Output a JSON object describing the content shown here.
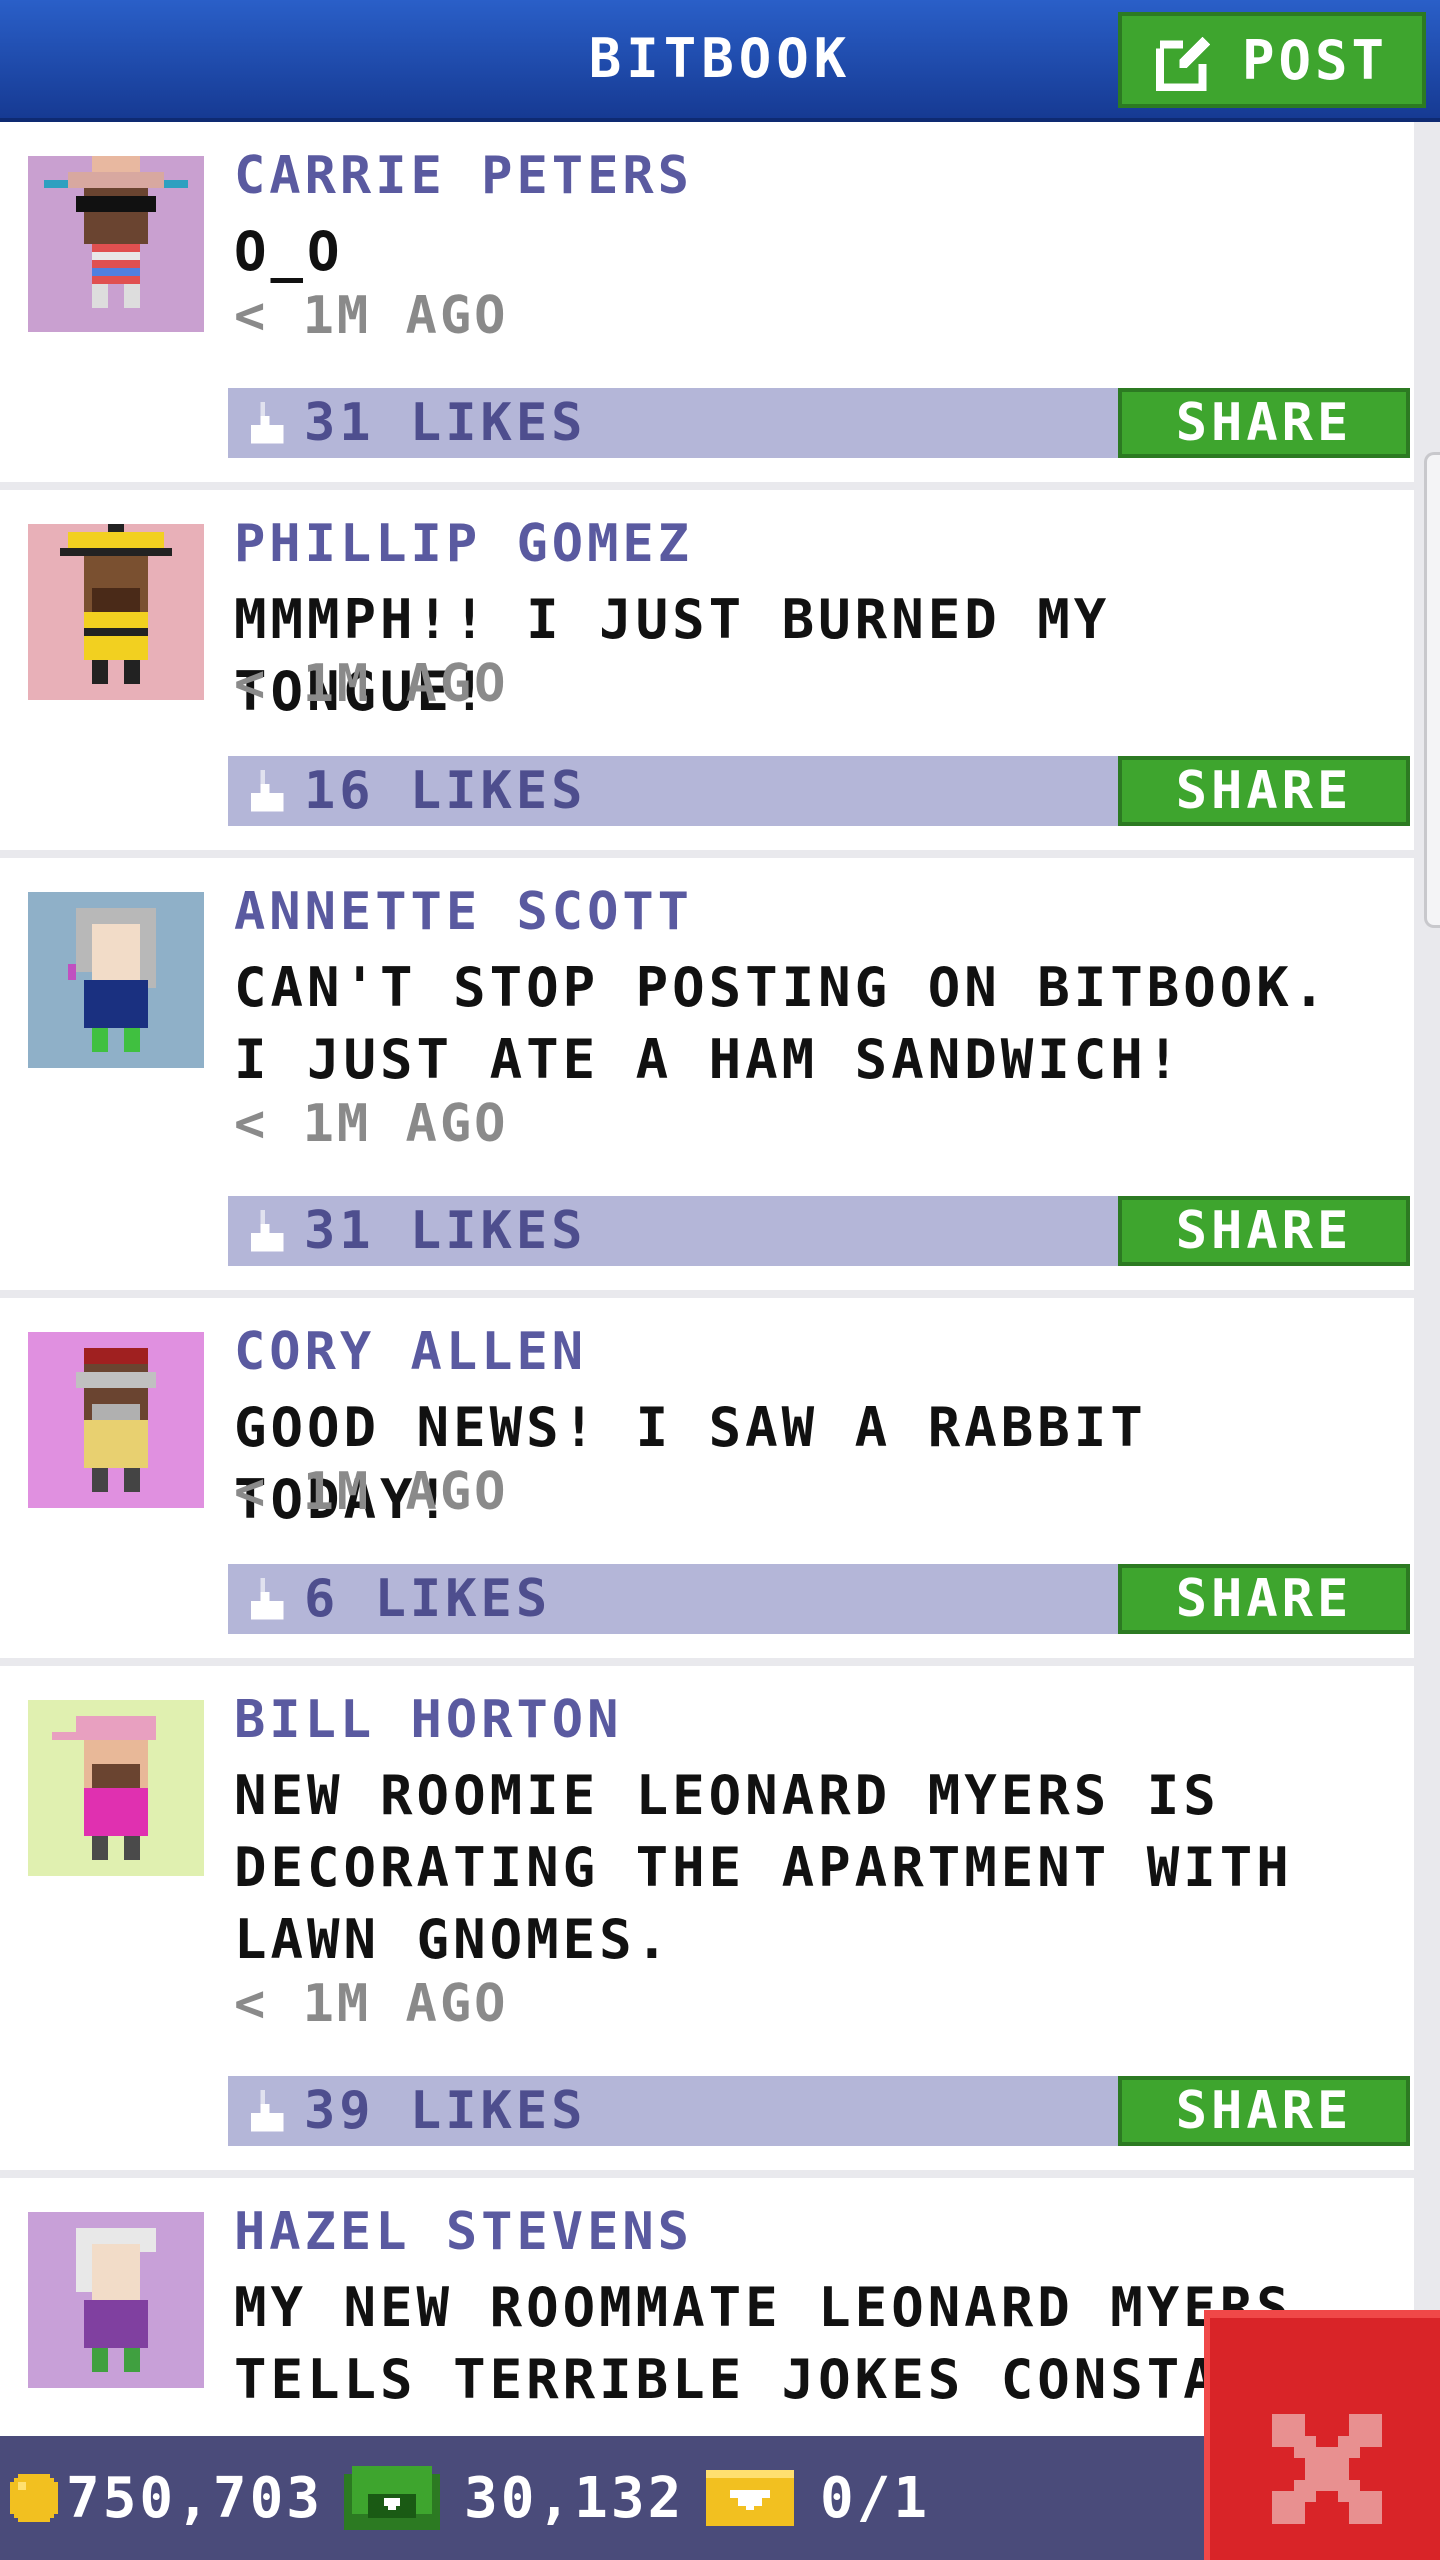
{
  "header": {
    "title": "BITBOOK",
    "post_label": "POST"
  },
  "posts": [
    {
      "name": "CARRIE PETERS",
      "message": "O_O",
      "time": "< 1M AGO",
      "likes": "31 LIKES",
      "share": "SHARE"
    },
    {
      "name": "PHILLIP GOMEZ",
      "message": "MMMPH!! I JUST BURNED MY TONGUE!",
      "time": "< 1M AGO",
      "likes": "16 LIKES",
      "share": "SHARE"
    },
    {
      "name": "ANNETTE SCOTT",
      "message": "CAN'T STOP POSTING ON BITBOOK. I JUST ATE A HAM SANDWICH!",
      "time": "< 1M AGO",
      "likes": "31 LIKES",
      "share": "SHARE"
    },
    {
      "name": "CORY ALLEN",
      "message": "GOOD NEWS! I SAW A RABBIT TODAY!",
      "time": "< 1M AGO",
      "likes": "6 LIKES",
      "share": "SHARE"
    },
    {
      "name": "BILL HORTON",
      "message": "NEW ROOMIE LEONARD MYERS IS DECORATING THE APARTMENT WITH LAWN GNOMES.",
      "time": "< 1M AGO",
      "likes": "39 LIKES",
      "share": "SHARE"
    },
    {
      "name": "HAZEL STEVENS",
      "message": "MY NEW ROOMMATE LEONARD MYERS TELLS TERRIBLE JOKES CONSTAN"
    }
  ],
  "bottom_bar": {
    "coins": "750,703",
    "bux": "30,132",
    "tickets": "0/1"
  },
  "colors": {
    "header_blue": "#1f4aa8",
    "button_green": "#3ea52e",
    "likes_bar": "#b4b6d8",
    "name_purple": "#5a5aa0",
    "close_red": "#d92428"
  }
}
